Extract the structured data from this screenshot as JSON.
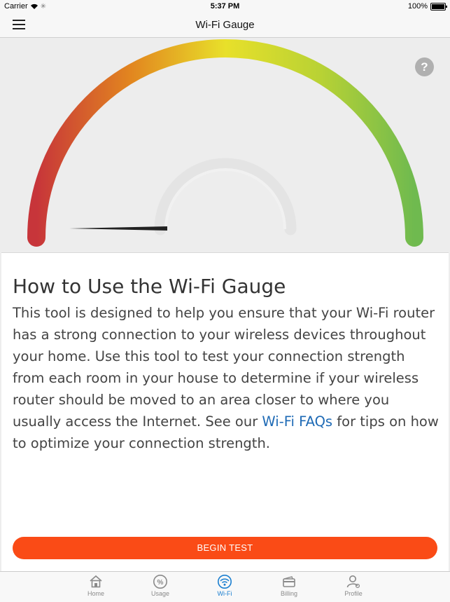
{
  "status_bar": {
    "carrier": "Carrier",
    "time": "5:37 PM",
    "battery": "100%"
  },
  "nav": {
    "title": "Wi-Fi Gauge"
  },
  "gauge": {
    "help_symbol": "?",
    "level": 0.0
  },
  "info": {
    "heading": "How to Use the Wi-Fi Gauge",
    "body_before_link": "This tool is designed to help you ensure that your Wi-Fi router has a strong connection to your wireless devices throughout your home. Use this tool to test your connection strength from each room in your house to determine if your wireless router should be moved to an area closer to where you usually access the Internet. See our ",
    "link_text": "Wi-Fi FAQs",
    "body_after_link": " for tips on how to optimize your connection strength."
  },
  "actions": {
    "begin_test": "BEGIN TEST"
  },
  "tabs": [
    {
      "label": "Home",
      "icon": "home-icon",
      "active": false
    },
    {
      "label": "Usage",
      "icon": "percent-icon",
      "active": false
    },
    {
      "label": "Wi-Fi",
      "icon": "wifi-icon",
      "active": true
    },
    {
      "label": "Billing",
      "icon": "wallet-icon",
      "active": false
    },
    {
      "label": "Profile",
      "icon": "profile-icon",
      "active": false
    }
  ],
  "colors": {
    "accent": "#fa4b16",
    "active_tab": "#1b7fd0",
    "link": "#1e6ab5",
    "gauge_low": "#c7353a",
    "gauge_mid": "#e8e02a",
    "gauge_high": "#6fba4f"
  }
}
